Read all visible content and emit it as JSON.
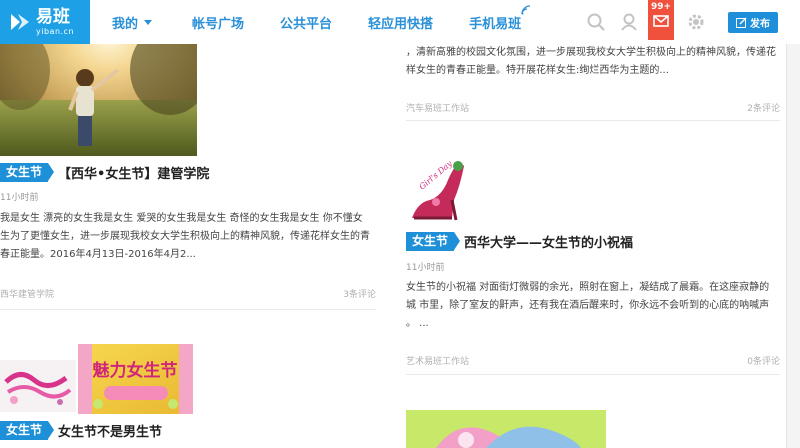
{
  "header": {
    "logo_cn": "易班",
    "logo_en": "yiban.cn",
    "nav": [
      "我的",
      "帐号广场",
      "公共平台",
      "轻应用快搭",
      "手机易班"
    ],
    "mail_badge": "99+",
    "publish_label": "发布"
  },
  "colors": {
    "brand": "#1ea0e6",
    "tag": "#1e90d8",
    "nav_text": "#2a90d8",
    "mail": "#f0513c"
  },
  "left_column": [
    {
      "tag": "女生节",
      "title": "【西华•女生节】建管学院",
      "time": "11小时前",
      "summary_lines": [
        "我是女生 漂亮的女生我是女生 爱哭的女生我是女生 奇怪的女生我是女生 你不懂女",
        "生为了更懂女生，进一步展现我校女大学生积极向上的精神风貌，传递花样女生的青",
        "春正能量。2016年4月13日-2016年4月2..."
      ],
      "source": "西华建管学院",
      "comments": "3条评论"
    },
    {
      "tag": "女生节",
      "title": "女生节不是男生节",
      "image_text": "魅力女生节"
    }
  ],
  "right_column": [
    {
      "summary_lines": [
        "，清新高雅的校园文化氛围，进一步展现我校女大学生积极向上的精神风貌，传递花",
        "样女生的青春正能量。特开展花样女生:绚烂西华为主题的..."
      ],
      "source": "汽车易班工作站",
      "comments": "2条评论"
    },
    {
      "image_text": "Girl's Day",
      "tag": "女生节",
      "title": "西华大学——女生节的小祝福",
      "time": "11小时前",
      "summary_lines": [
        "女生节的小祝福 对面街灯微弱的余光，照射在窗上，凝结成了晨霜。在这座寂静的",
        "城 市里，除了室友的鼾声，还有我在酒后醒来时，你永远不会听到的心底的呐喊声",
        "。 ..."
      ],
      "source": "艺术易班工作站",
      "comments": "0条评论"
    }
  ]
}
